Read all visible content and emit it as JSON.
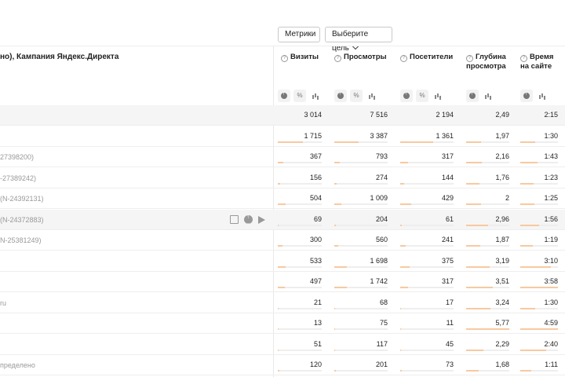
{
  "toolbar": {
    "metrics_label": "Метрики",
    "goal_label": "Выберите цель"
  },
  "dimension_header": "но), Кампания Яндекс.Директа",
  "columns": [
    {
      "key": "visits",
      "label1": "Визиты",
      "label2": ""
    },
    {
      "key": "views",
      "label1": "Просмотры",
      "label2": ""
    },
    {
      "key": "visitors",
      "label1": "Посетители",
      "label2": ""
    },
    {
      "key": "depth",
      "label1": "Глубина",
      "label2": "просмотра"
    },
    {
      "key": "time",
      "label1": "Время",
      "label2": "на сайте"
    }
  ],
  "total": {
    "label": "",
    "visits": "3 014",
    "views": "7 516",
    "visitors": "2 194",
    "depth": "2,49",
    "time": "2:15"
  },
  "rows": [
    {
      "label": "",
      "visits": "1 715",
      "views": "3 387",
      "visitors": "1 361",
      "depth": "1,97",
      "time": "1:30",
      "bars": [
        0.57,
        0.45,
        0.62,
        0.34,
        0.4
      ]
    },
    {
      "label": "27398200)",
      "visits": "367",
      "views": "793",
      "visitors": "317",
      "depth": "2,16",
      "time": "1:43",
      "bars": [
        0.12,
        0.11,
        0.14,
        0.37,
        0.45
      ]
    },
    {
      "label": "-27389242)",
      "visits": "156",
      "views": "274",
      "visitors": "144",
      "depth": "1,76",
      "time": "1:23",
      "bars": [
        0.05,
        0.04,
        0.07,
        0.3,
        0.36
      ]
    },
    {
      "label": "(N-24392131)",
      "visits": "504",
      "views": "1 009",
      "visitors": "429",
      "depth": "2",
      "time": "1:25",
      "bars": [
        0.17,
        0.13,
        0.2,
        0.35,
        0.37
      ]
    },
    {
      "label": "(N-24372883)",
      "visits": "69",
      "views": "204",
      "visitors": "61",
      "depth": "2,96",
      "time": "1:56",
      "bars": [
        0.02,
        0.03,
        0.03,
        0.51,
        0.5
      ]
    },
    {
      "label": "N-25381249)",
      "visits": "300",
      "views": "560",
      "visitors": "241",
      "depth": "1,87",
      "time": "1:19",
      "bars": [
        0.1,
        0.07,
        0.11,
        0.32,
        0.34
      ]
    },
    {
      "label": "",
      "visits": "533",
      "views": "1 698",
      "visitors": "375",
      "depth": "3,19",
      "time": "3:10",
      "bars": [
        0.18,
        0.23,
        0.17,
        0.55,
        0.82
      ]
    },
    {
      "label": "",
      "visits": "497",
      "views": "1 742",
      "visitors": "317",
      "depth": "3,51",
      "time": "3:58",
      "bars": [
        0.16,
        0.23,
        0.14,
        0.61,
        1.0
      ]
    },
    {
      "label": "ru",
      "visits": "21",
      "views": "68",
      "visitors": "17",
      "depth": "3,24",
      "time": "1:30",
      "bars": [
        0.01,
        0.01,
        0.01,
        0.56,
        0.39
      ]
    },
    {
      "label": "",
      "visits": "13",
      "views": "75",
      "visitors": "11",
      "depth": "5,77",
      "time": "4:59",
      "bars": [
        0.005,
        0.01,
        0.005,
        1.0,
        1.0
      ]
    },
    {
      "label": "",
      "visits": "51",
      "views": "117",
      "visitors": "45",
      "depth": "2,29",
      "time": "2:40",
      "bars": [
        0.02,
        0.02,
        0.02,
        0.4,
        0.69
      ]
    },
    {
      "label": "пределено",
      "visits": "120",
      "views": "201",
      "visitors": "73",
      "depth": "1,68",
      "time": "1:11",
      "bars": [
        0.04,
        0.03,
        0.03,
        0.29,
        0.3
      ]
    }
  ],
  "highlighted_row": 4,
  "colors": {
    "bar": "#f8c9a0",
    "bar_bg": "#eeeeee",
    "total_bg": "#f5f5f5"
  }
}
